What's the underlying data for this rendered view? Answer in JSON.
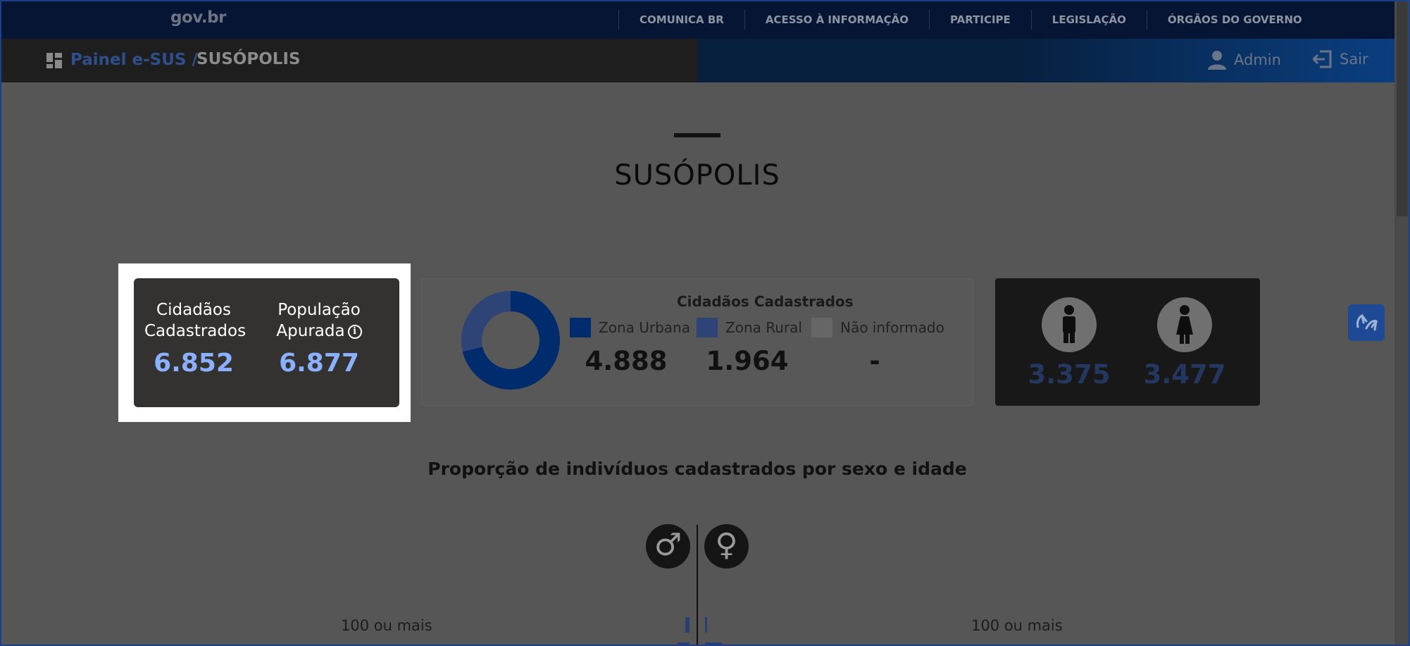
{
  "gov_header": {
    "logo_text": "gov.br",
    "nav": [
      "COMUNICA BR",
      "ACESSO À INFORMAÇÃO",
      "PARTICIPE",
      "LEGISLAÇÃO",
      "ÓRGÃOS DO GOVERNO"
    ]
  },
  "app_header": {
    "breadcrumb_root": "Painel e-SUS /",
    "breadcrumb_current": "SUSÓPOLIS",
    "user_label": "Admin",
    "logout_label": "Sair"
  },
  "page": {
    "title": "SUSÓPOLIS"
  },
  "summary_card": {
    "registered_label_line1": "Cidadãos",
    "registered_label_line2": "Cadastrados",
    "registered_value": "6.852",
    "population_label_line1": "População",
    "population_label_line2": "Apurada",
    "population_value": "6.877"
  },
  "zone_card": {
    "title": "Cidadãos Cadastrados",
    "zones": [
      {
        "label": "Zona Urbana",
        "value": "4.888",
        "color": "#002c6e"
      },
      {
        "label": "Zona Rural",
        "value": "1.964",
        "color": "#2e4476"
      },
      {
        "label": "Não informado",
        "value": "-",
        "color": "#666666"
      }
    ],
    "donut_fractions": [
      0.7133,
      0.2867,
      0
    ]
  },
  "gender_card": {
    "male_value": "3.375",
    "female_value": "3.477"
  },
  "pyramid": {
    "title": "Proporção de indivíduos cadastrados por sexo e idade",
    "male_symbol": "♂",
    "female_symbol": "♀",
    "first_age_group_left": "100 ou mais",
    "first_age_group_right": "100 ou mais"
  },
  "colors": {
    "accent_blue": "#8ab0ff",
    "top_bar": "#071534",
    "highlight": "#ffffff"
  }
}
